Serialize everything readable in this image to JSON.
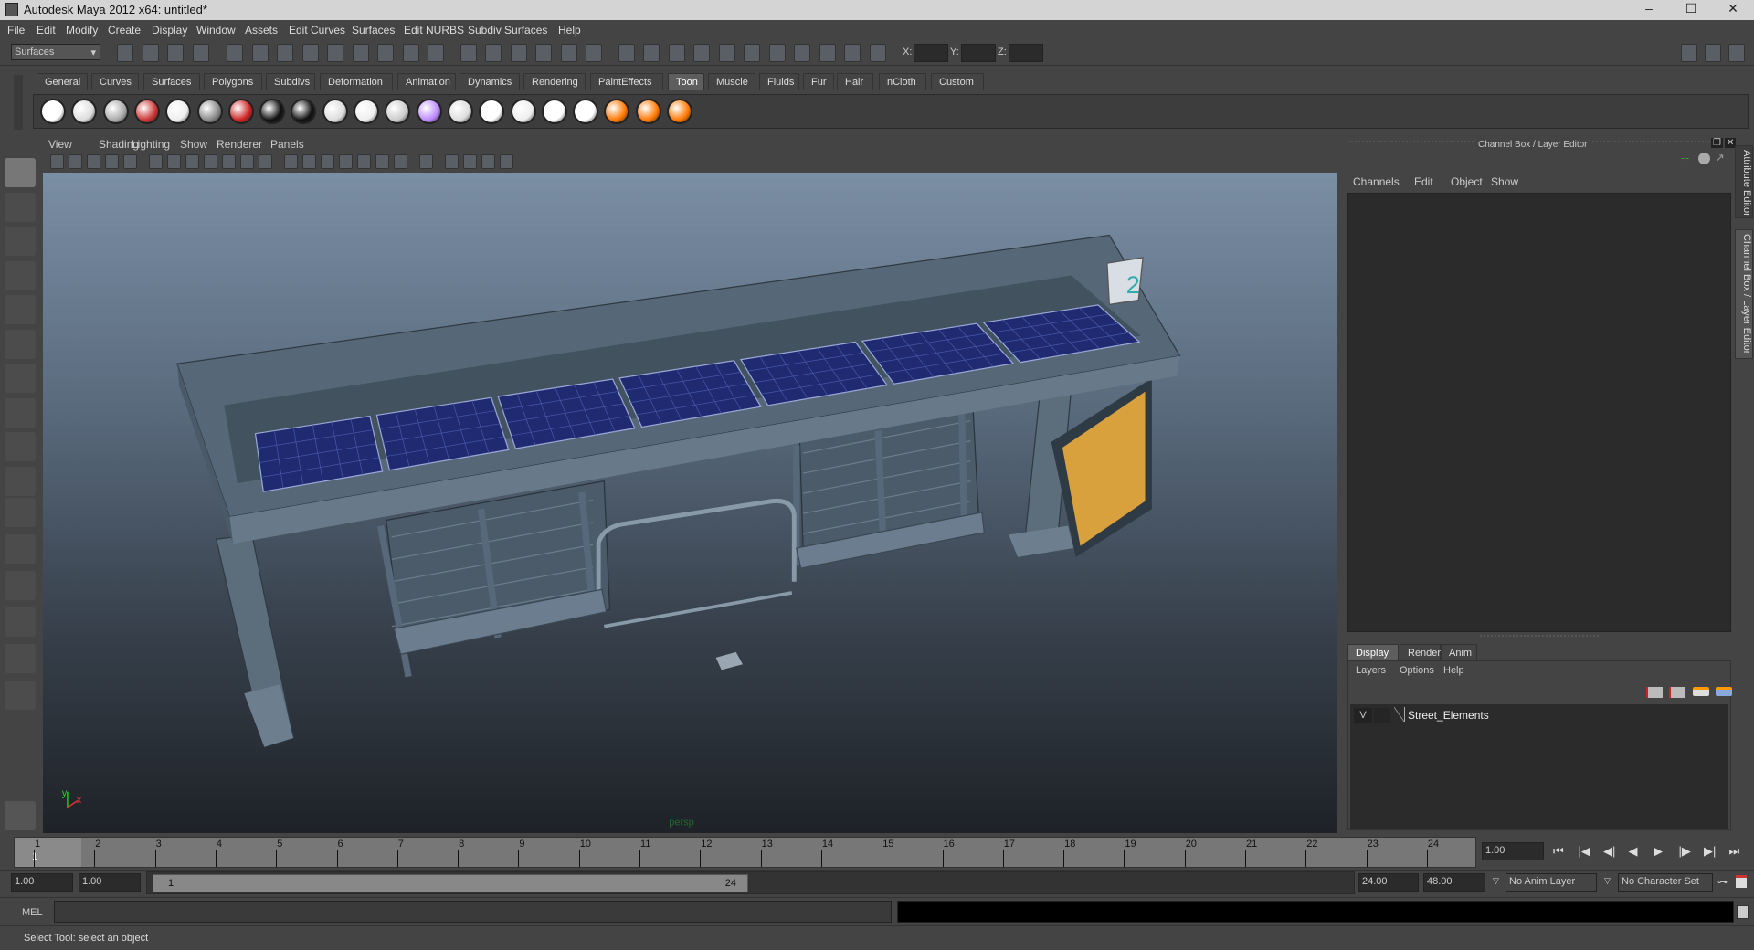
{
  "window": {
    "title": "Autodesk Maya 2012 x64: untitled*",
    "minimize": "–",
    "maximize": "☐",
    "close": "✕"
  },
  "menubar": [
    "File",
    "Edit",
    "Modify",
    "Create",
    "Display",
    "Window",
    "Assets",
    "Edit Curves",
    "Surfaces",
    "Edit NURBS",
    "Subdiv Surfaces",
    "Help"
  ],
  "statusline": {
    "mode": "Surfaces",
    "x_label": "X:",
    "y_label": "Y:",
    "z_label": "Z:"
  },
  "shelf": {
    "tabs": [
      "General",
      "Curves",
      "Surfaces",
      "Polygons",
      "Subdivs",
      "Deformation",
      "Animation",
      "Dynamics",
      "Rendering",
      "PaintEffects",
      "Toon",
      "Muscle",
      "Fluids",
      "Fur",
      "Hair",
      "nCloth",
      "Custom"
    ],
    "active": "Toon"
  },
  "panel": {
    "menus": [
      "View",
      "Shading",
      "Lighting",
      "Show",
      "Renderer",
      "Panels"
    ],
    "camera_label": "persp",
    "axis_x": "x",
    "axis_y": "y",
    "sign_number": "2"
  },
  "channelbox": {
    "title": "Channel Box / Layer Editor",
    "menus": [
      "Channels",
      "Edit",
      "Object",
      "Show"
    ]
  },
  "layereditor": {
    "tabs": [
      "Display",
      "Render",
      "Anim"
    ],
    "active_tab": "Display",
    "menus": [
      "Layers",
      "Options",
      "Help"
    ],
    "layers": [
      {
        "visible": "V",
        "name": "Street_Elements"
      }
    ]
  },
  "side_tabs": [
    "Attribute Editor",
    "Channel Box / Layer Editor"
  ],
  "timeline": {
    "ticks": [
      "1",
      "2",
      "3",
      "4",
      "5",
      "6",
      "7",
      "8",
      "9",
      "10",
      "11",
      "12",
      "13",
      "14",
      "15",
      "16",
      "17",
      "18",
      "19",
      "20",
      "21",
      "22",
      "23",
      "24"
    ],
    "current_marker": "1",
    "current_time": "1.00"
  },
  "playback": {
    "go_start": "⏮",
    "step_back_key": "|◀",
    "step_back": "◀|",
    "play_back": "◀",
    "play_forward": "▶",
    "step_fwd": "|▶",
    "step_fwd_key": "▶|",
    "go_end": "⏭"
  },
  "range": {
    "start": "1.00",
    "playback_start": "1.00",
    "handle_start": "1",
    "handle_end": "24",
    "playback_end": "24.00",
    "end": "48.00",
    "anim_layer": "No Anim Layer",
    "character_set": "No Character Set"
  },
  "command": {
    "label": "MEL",
    "value": ""
  },
  "helpline": "Select Tool: select an object",
  "colors": {
    "accent": "#5e5e5e",
    "viewport_top": "#7a8ea4",
    "viewport_bottom": "#1e2227",
    "solar": "#1f2a70"
  }
}
